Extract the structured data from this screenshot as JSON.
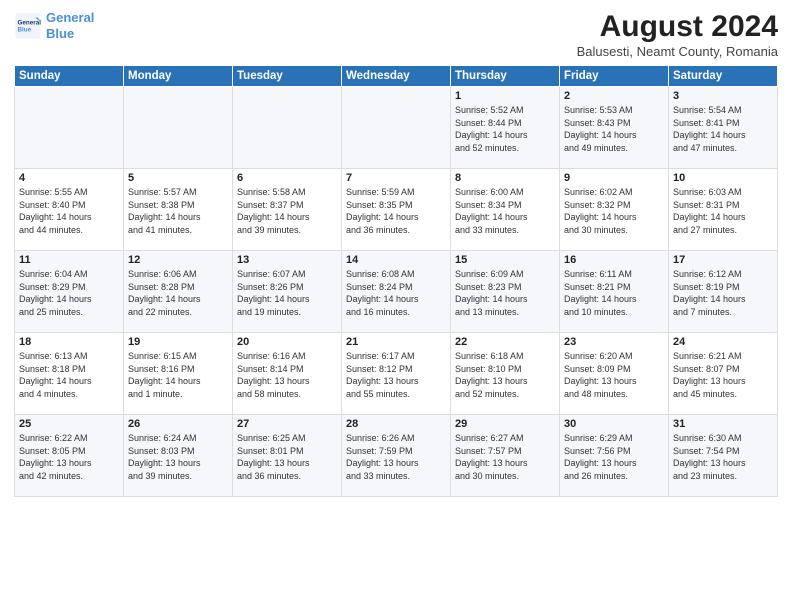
{
  "logo": {
    "line1": "General",
    "line2": "Blue"
  },
  "title": "August 2024",
  "subtitle": "Balusesti, Neamt County, Romania",
  "headers": [
    "Sunday",
    "Monday",
    "Tuesday",
    "Wednesday",
    "Thursday",
    "Friday",
    "Saturday"
  ],
  "weeks": [
    [
      {
        "day": "",
        "info": ""
      },
      {
        "day": "",
        "info": ""
      },
      {
        "day": "",
        "info": ""
      },
      {
        "day": "",
        "info": ""
      },
      {
        "day": "1",
        "info": "Sunrise: 5:52 AM\nSunset: 8:44 PM\nDaylight: 14 hours\nand 52 minutes."
      },
      {
        "day": "2",
        "info": "Sunrise: 5:53 AM\nSunset: 8:43 PM\nDaylight: 14 hours\nand 49 minutes."
      },
      {
        "day": "3",
        "info": "Sunrise: 5:54 AM\nSunset: 8:41 PM\nDaylight: 14 hours\nand 47 minutes."
      }
    ],
    [
      {
        "day": "4",
        "info": "Sunrise: 5:55 AM\nSunset: 8:40 PM\nDaylight: 14 hours\nand 44 minutes."
      },
      {
        "day": "5",
        "info": "Sunrise: 5:57 AM\nSunset: 8:38 PM\nDaylight: 14 hours\nand 41 minutes."
      },
      {
        "day": "6",
        "info": "Sunrise: 5:58 AM\nSunset: 8:37 PM\nDaylight: 14 hours\nand 39 minutes."
      },
      {
        "day": "7",
        "info": "Sunrise: 5:59 AM\nSunset: 8:35 PM\nDaylight: 14 hours\nand 36 minutes."
      },
      {
        "day": "8",
        "info": "Sunrise: 6:00 AM\nSunset: 8:34 PM\nDaylight: 14 hours\nand 33 minutes."
      },
      {
        "day": "9",
        "info": "Sunrise: 6:02 AM\nSunset: 8:32 PM\nDaylight: 14 hours\nand 30 minutes."
      },
      {
        "day": "10",
        "info": "Sunrise: 6:03 AM\nSunset: 8:31 PM\nDaylight: 14 hours\nand 27 minutes."
      }
    ],
    [
      {
        "day": "11",
        "info": "Sunrise: 6:04 AM\nSunset: 8:29 PM\nDaylight: 14 hours\nand 25 minutes."
      },
      {
        "day": "12",
        "info": "Sunrise: 6:06 AM\nSunset: 8:28 PM\nDaylight: 14 hours\nand 22 minutes."
      },
      {
        "day": "13",
        "info": "Sunrise: 6:07 AM\nSunset: 8:26 PM\nDaylight: 14 hours\nand 19 minutes."
      },
      {
        "day": "14",
        "info": "Sunrise: 6:08 AM\nSunset: 8:24 PM\nDaylight: 14 hours\nand 16 minutes."
      },
      {
        "day": "15",
        "info": "Sunrise: 6:09 AM\nSunset: 8:23 PM\nDaylight: 14 hours\nand 13 minutes."
      },
      {
        "day": "16",
        "info": "Sunrise: 6:11 AM\nSunset: 8:21 PM\nDaylight: 14 hours\nand 10 minutes."
      },
      {
        "day": "17",
        "info": "Sunrise: 6:12 AM\nSunset: 8:19 PM\nDaylight: 14 hours\nand 7 minutes."
      }
    ],
    [
      {
        "day": "18",
        "info": "Sunrise: 6:13 AM\nSunset: 8:18 PM\nDaylight: 14 hours\nand 4 minutes."
      },
      {
        "day": "19",
        "info": "Sunrise: 6:15 AM\nSunset: 8:16 PM\nDaylight: 14 hours\nand 1 minute."
      },
      {
        "day": "20",
        "info": "Sunrise: 6:16 AM\nSunset: 8:14 PM\nDaylight: 13 hours\nand 58 minutes."
      },
      {
        "day": "21",
        "info": "Sunrise: 6:17 AM\nSunset: 8:12 PM\nDaylight: 13 hours\nand 55 minutes."
      },
      {
        "day": "22",
        "info": "Sunrise: 6:18 AM\nSunset: 8:10 PM\nDaylight: 13 hours\nand 52 minutes."
      },
      {
        "day": "23",
        "info": "Sunrise: 6:20 AM\nSunset: 8:09 PM\nDaylight: 13 hours\nand 48 minutes."
      },
      {
        "day": "24",
        "info": "Sunrise: 6:21 AM\nSunset: 8:07 PM\nDaylight: 13 hours\nand 45 minutes."
      }
    ],
    [
      {
        "day": "25",
        "info": "Sunrise: 6:22 AM\nSunset: 8:05 PM\nDaylight: 13 hours\nand 42 minutes."
      },
      {
        "day": "26",
        "info": "Sunrise: 6:24 AM\nSunset: 8:03 PM\nDaylight: 13 hours\nand 39 minutes."
      },
      {
        "day": "27",
        "info": "Sunrise: 6:25 AM\nSunset: 8:01 PM\nDaylight: 13 hours\nand 36 minutes."
      },
      {
        "day": "28",
        "info": "Sunrise: 6:26 AM\nSunset: 7:59 PM\nDaylight: 13 hours\nand 33 minutes."
      },
      {
        "day": "29",
        "info": "Sunrise: 6:27 AM\nSunset: 7:57 PM\nDaylight: 13 hours\nand 30 minutes."
      },
      {
        "day": "30",
        "info": "Sunrise: 6:29 AM\nSunset: 7:56 PM\nDaylight: 13 hours\nand 26 minutes."
      },
      {
        "day": "31",
        "info": "Sunrise: 6:30 AM\nSunset: 7:54 PM\nDaylight: 13 hours\nand 23 minutes."
      }
    ]
  ]
}
